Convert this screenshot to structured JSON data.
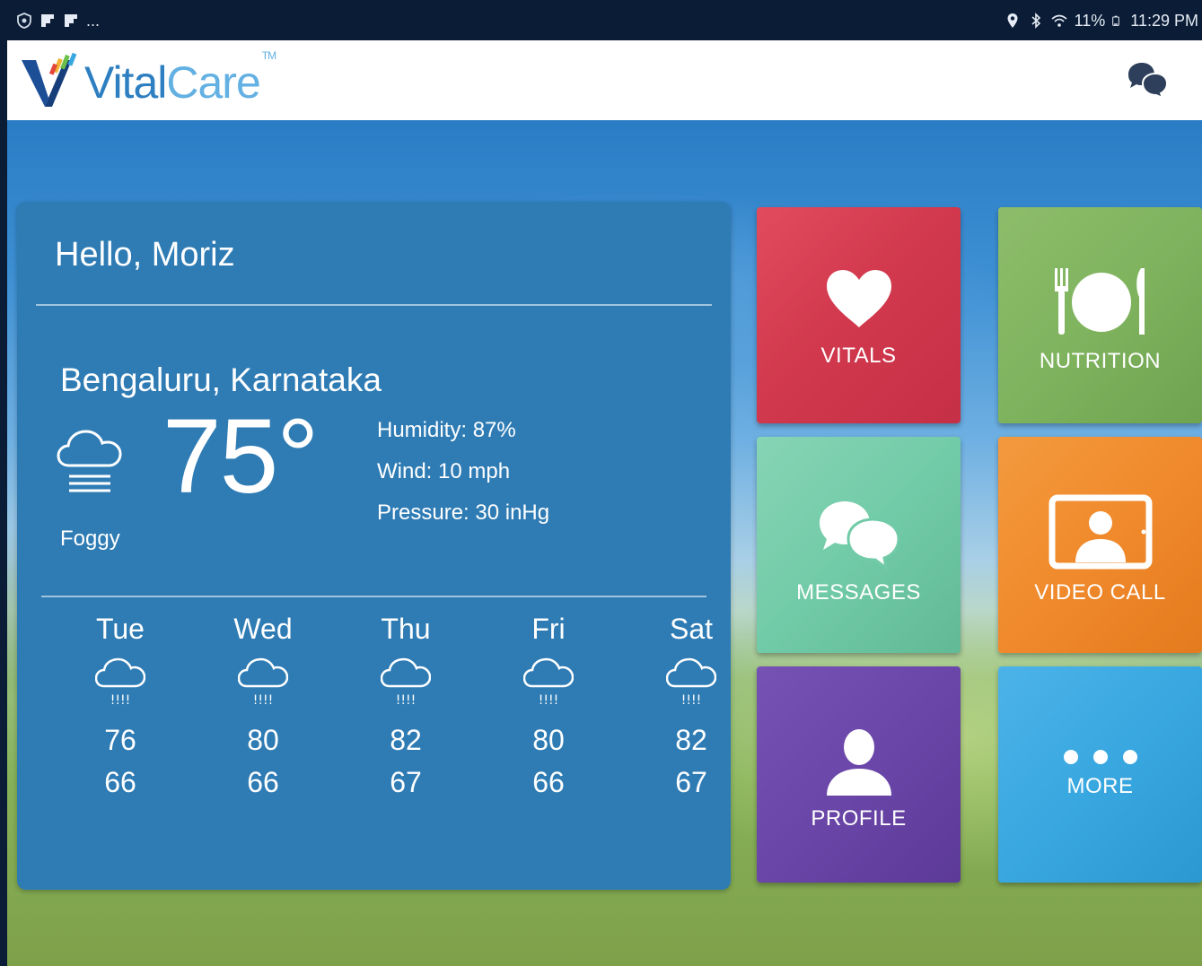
{
  "status_bar": {
    "time": "11:29 PM",
    "battery": "11%",
    "overflow": "..."
  },
  "app": {
    "logo_vital": "Vital",
    "logo_care": "Care",
    "logo_tm": "TM"
  },
  "weather": {
    "greeting": "Hello, Moriz",
    "location": "Bengaluru, Karnataka",
    "temperature": "75°",
    "condition": "Foggy",
    "humidity": "Humidity: 87%",
    "wind": "Wind: 10 mph",
    "pressure": "Pressure: 30 inHg",
    "forecast": [
      {
        "day": "Tue",
        "high": "76",
        "low": "66"
      },
      {
        "day": "Wed",
        "high": "80",
        "low": "66"
      },
      {
        "day": "Thu",
        "high": "82",
        "low": "67"
      },
      {
        "day": "Fri",
        "high": "80",
        "low": "66"
      },
      {
        "day": "Sat",
        "high": "82",
        "low": "67"
      }
    ]
  },
  "tiles": {
    "vitals": {
      "label": "VITALS",
      "color": "#d73a4f"
    },
    "nutrition": {
      "label": "NUTRITION",
      "color": "#7fb35e"
    },
    "messages": {
      "label": "MESSAGES",
      "color": "#72cba8"
    },
    "video_call": {
      "label": "VIDEO CALL",
      "color": "#f08a2c"
    },
    "profile": {
      "label": "PROFILE",
      "color": "#6a46a8"
    },
    "more": {
      "label": "MORE",
      "color": "#39a7e0"
    }
  }
}
